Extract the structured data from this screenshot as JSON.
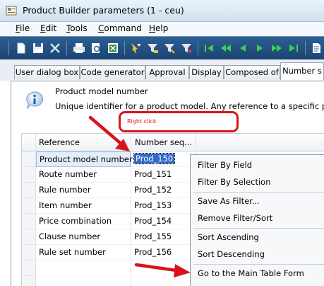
{
  "window": {
    "title": "Product Builder parameters (1 - ceu)"
  },
  "menu": [
    {
      "key": "F",
      "rest": "ile"
    },
    {
      "key": "E",
      "rest": "dit"
    },
    {
      "key": "T",
      "rest": "ools"
    },
    {
      "key": "C",
      "rest": "ommand"
    },
    {
      "key": "H",
      "rest": "elp"
    }
  ],
  "toolbar": {
    "icons": [
      "new-icon",
      "save-icon",
      "delete-icon",
      "print-icon",
      "print-preview-icon",
      "export-excel-icon",
      "filter-by-selection-icon",
      "filter-icon",
      "advanced-filter-icon",
      "remove-filter-icon",
      "first-record-icon",
      "previous-page-icon",
      "previous-record-icon",
      "next-record-icon",
      "next-page-icon",
      "last-record-icon",
      "document-icon"
    ]
  },
  "tabs": [
    {
      "label": "User dialog box",
      "active": false
    },
    {
      "label": "Code generator",
      "active": false
    },
    {
      "label": "Approval",
      "active": false
    },
    {
      "label": "Display",
      "active": false
    },
    {
      "label": "Composed of",
      "active": false
    },
    {
      "label": "Number s",
      "active": true
    }
  ],
  "info": {
    "title": "Product model number",
    "description": "Unique identifier for a product model. Any reference to a specific produc"
  },
  "grid": {
    "columns": [
      "Reference",
      "Number seq..."
    ],
    "rows": [
      {
        "reference": "Product model number",
        "number": "Prod_150"
      },
      {
        "reference": "Route number",
        "number": "Prod_151"
      },
      {
        "reference": "Rule number",
        "number": "Prod_152"
      },
      {
        "reference": "Item number",
        "number": "Prod_153"
      },
      {
        "reference": "Price combination",
        "number": "Prod_154"
      },
      {
        "reference": "Clause number",
        "number": "Prod_155"
      },
      {
        "reference": "Rule set number",
        "number": "Prod_156"
      }
    ]
  },
  "callout": {
    "text": "Right click"
  },
  "context_menu": {
    "items": [
      "Filter By Field",
      "Filter By Selection",
      "Save As Filter...",
      "Remove Filter/Sort",
      "Sort Ascending",
      "Sort Descending",
      "Go to the Main Table Form"
    ]
  },
  "colors": {
    "annotation_red": "#d8141b",
    "selection_blue": "#316ac5",
    "toolbar_blue": "#2c5f93"
  }
}
